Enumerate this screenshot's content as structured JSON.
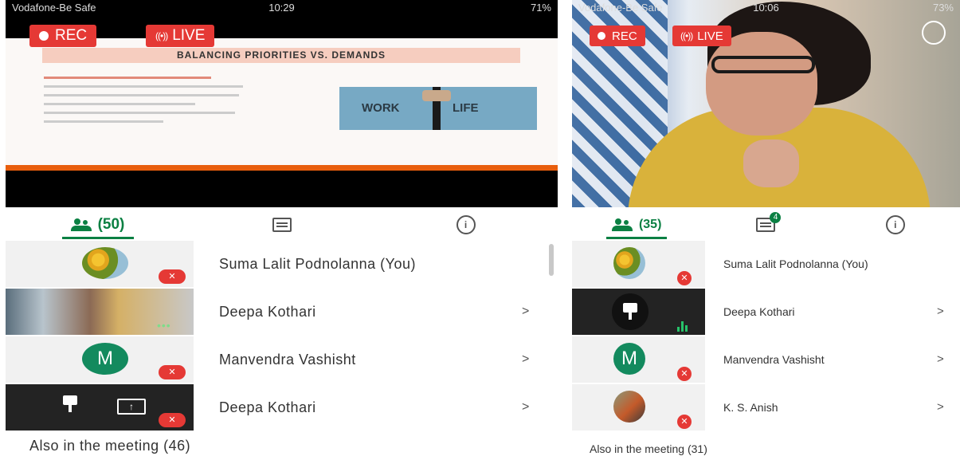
{
  "left": {
    "status": {
      "carrier": "Vodafone-Be Safe",
      "time": "10:29",
      "battery": "71%"
    },
    "rec_label": "REC",
    "live_label": "LIVE",
    "slide_title": "BALANCING PRIORITIES VS. DEMANDS",
    "slide_image_words": [
      "WORK",
      "LIFE"
    ],
    "people_count": "(50)",
    "participants": [
      {
        "name": "Suma Lalit Podnolanna (You)",
        "avatar": "flower",
        "muted": true
      },
      {
        "name": "Deepa Kothari",
        "avatar": "camera",
        "muted": false
      },
      {
        "name": "Manvendra Vashisht",
        "avatar": "M",
        "muted": true
      },
      {
        "name": "Deepa Kothari",
        "avatar": "screen-share",
        "muted": true
      }
    ],
    "chevron": ">",
    "also_in_meeting": "Also in the meeting (46)"
  },
  "right": {
    "status": {
      "carrier": "Vodafone-Be Safe",
      "time": "10:06",
      "battery": "73%"
    },
    "rec_label": "REC",
    "live_label": "LIVE",
    "people_count": "(35)",
    "chat_badge": "4",
    "participants": [
      {
        "name": "Suma Lalit Podnolanna (You)",
        "avatar": "flower",
        "muted": true
      },
      {
        "name": "Deepa Kothari",
        "avatar": "pin",
        "muted": false
      },
      {
        "name": "Manvendra Vashisht",
        "avatar": "M",
        "muted": true
      },
      {
        "name": "K. S. Anish",
        "avatar": "photo",
        "muted": true
      }
    ],
    "chevron": ">",
    "also_in_meeting": "Also in the meeting (31)"
  },
  "colors": {
    "accent": "#0b8043",
    "rec": "#e53935",
    "slide_accent": "#e85e0d"
  },
  "icons": {
    "people": "people-icon",
    "chat": "chat-icon",
    "info": "info-icon",
    "mute": "mic-off-icon",
    "pin": "pin-icon",
    "present": "present-screen-icon",
    "chevron": "chevron-right-icon"
  }
}
